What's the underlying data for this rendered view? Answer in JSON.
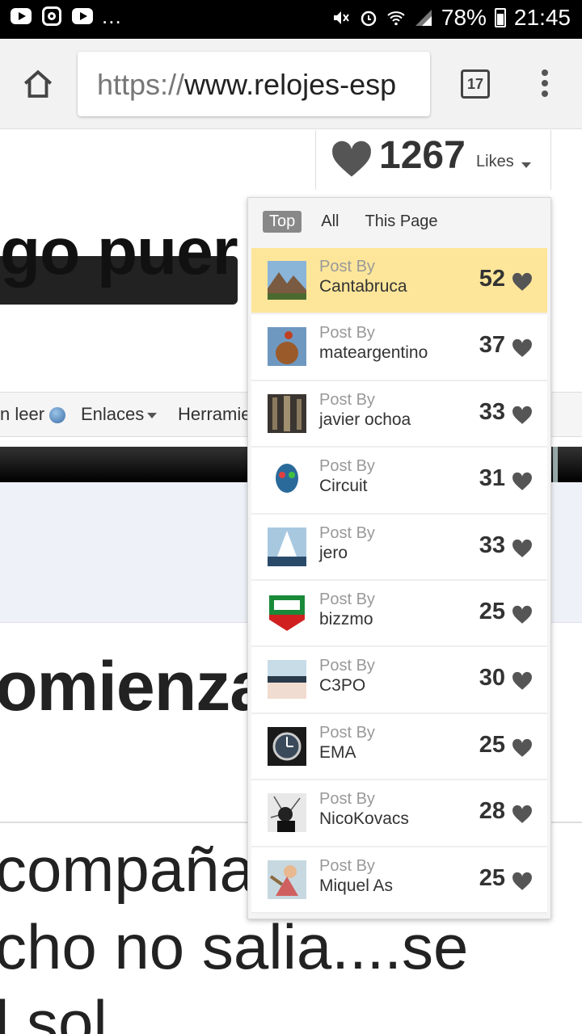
{
  "status_bar": {
    "icons_left": [
      "youtube-icon",
      "instagram-icon",
      "youtube-icon"
    ],
    "overflow": "...",
    "battery": "78%",
    "time": "21:45"
  },
  "browser": {
    "url_scheme": "https://",
    "url_rest": "www.relojes-esp",
    "tab_count": "17"
  },
  "page": {
    "headline": "go puer",
    "nav": {
      "item1": "n leer",
      "item2": "Enlaces",
      "item3": "Herramie"
    },
    "subhead": "omienza",
    "line1": "compaña",
    "line2": "cho no salia....se",
    "line3": "l sol"
  },
  "likes": {
    "count": "1267",
    "label": "Likes",
    "tabs": [
      "Top",
      "All",
      "This Page"
    ],
    "post_by_label": "Post By",
    "rows": [
      {
        "user": "Cantabruca",
        "likes": "52"
      },
      {
        "user": "mateargentino",
        "likes": "37"
      },
      {
        "user": "javier ochoa",
        "likes": "33"
      },
      {
        "user": "Circuit",
        "likes": "31"
      },
      {
        "user": "jero",
        "likes": "33"
      },
      {
        "user": "bizzmo",
        "likes": "25"
      },
      {
        "user": "C3PO",
        "likes": "30"
      },
      {
        "user": "EMA",
        "likes": "25"
      },
      {
        "user": "NicoKovacs",
        "likes": "28"
      },
      {
        "user": "Miquel As",
        "likes": "25"
      }
    ]
  },
  "colors": {
    "highlight": "#fde69a",
    "heart": "#555555",
    "active_tab": "#888888"
  }
}
